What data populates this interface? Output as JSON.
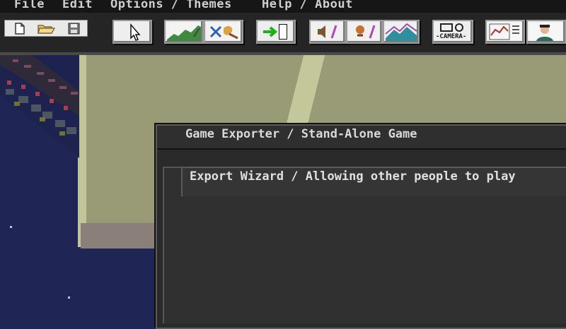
{
  "menu": {
    "file": "File",
    "edit": "Edit",
    "options_themes": "Options / Themes",
    "help_about": "Help / About"
  },
  "toolbar": {
    "tools": [
      {
        "icon": "new-file-icon"
      },
      {
        "icon": "open-folder-icon"
      },
      {
        "icon": "save-icon"
      },
      {
        "icon": "cursor-icon"
      },
      {
        "icon": "landscape-icon"
      },
      {
        "icon": "paint-icon"
      },
      {
        "icon": "exit-door-icon"
      },
      {
        "icon": "sound-icon"
      },
      {
        "icon": "effects-icon"
      },
      {
        "icon": "mountains-icon"
      },
      {
        "icon": "camera-icon"
      },
      {
        "icon": "graph-icon"
      },
      {
        "icon": "character-icon"
      }
    ],
    "camera_label": "-CAMERA-"
  },
  "dialogs": {
    "exporter_title": "Game Exporter / Stand-Alone Game",
    "wizard_title": "Export Wizard / Allowing other people to play"
  },
  "colors": {
    "background": "#1f2554",
    "menubar": "#161616",
    "toolbar": "#252525",
    "olive": "#999b77",
    "dialog": "#2a2a2a"
  }
}
